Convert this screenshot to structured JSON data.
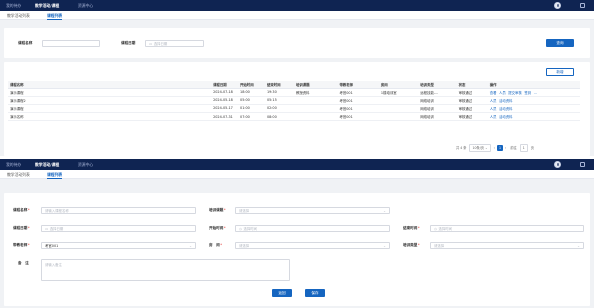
{
  "nav": {
    "items": [
      "我的待办",
      "教学活动/课程",
      "资源中心"
    ],
    "active_index": 1
  },
  "subtabs": {
    "items": [
      "教学活动列表",
      "课程列表"
    ],
    "active_index": 1
  },
  "list_view": {
    "search": {
      "course_name_label": "课程名称",
      "course_name_value": "",
      "course_date_label": "课程日期",
      "course_date_placeholder": "选择日期",
      "search_button": "查询"
    },
    "add_button": "新增",
    "table": {
      "columns": [
        "课程名称",
        "课程日期",
        "开始时间",
        "结束时间",
        "培训课题",
        "带教老师",
        "房间",
        "培训类型",
        "状态",
        "操作"
      ],
      "rows": [
        {
          "name": "演示课程",
          "date": "2024-07-18",
          "start": "18:00",
          "end": "19:30",
          "topic": "教授资料",
          "teacher": "考官001",
          "room": "1楼培训室",
          "type": "远程技能-...",
          "status": "审核通过",
          "actions": [
            "查看",
            "人员",
            "提交审核",
            "签到",
            "..."
          ]
        },
        {
          "name": "演示课程2",
          "date": "2024-05-18",
          "start": "05:00",
          "end": "05:15",
          "topic": "",
          "teacher": "考官001",
          "room": "",
          "type": "网络培训",
          "status": "审核通过",
          "actions": [
            "人员",
            "活动资料"
          ]
        },
        {
          "name": "演示课程",
          "date": "2024-05-17",
          "start": "01:00",
          "end": "02:00",
          "topic": "",
          "teacher": "考官001",
          "room": "",
          "type": "网络培训",
          "status": "审核通过",
          "actions": [
            "人员",
            "活动资料"
          ]
        },
        {
          "name": "演示名称",
          "date": "2024-07-31",
          "start": "07:00",
          "end": "08:00",
          "topic": "",
          "teacher": "考官001",
          "room": "",
          "type": "网络培训",
          "status": "审核通过",
          "actions": [
            "人员",
            "活动资料"
          ]
        }
      ]
    },
    "pagination": {
      "total": "共 4 条",
      "page_size": "10条/页",
      "prev": "‹",
      "current": "1",
      "next": "›",
      "goto_label": "前往",
      "goto_value": "1",
      "page_unit": "页"
    }
  },
  "form_view": {
    "name_label": "课程名称",
    "name_placeholder": "请输入课程名称",
    "topic_label": "培训课题",
    "topic_placeholder": "请选择",
    "date_label": "课程日期",
    "date_placeholder": "选择日期",
    "start_label": "开始时间",
    "start_placeholder": "选择时间",
    "end_label": "结束时间",
    "end_placeholder": "选择时间",
    "teacher_label": "带教老师",
    "teacher_value": "考官001",
    "room_label": "房　间",
    "room_placeholder": "请选择",
    "type_label": "培训类型",
    "type_placeholder": "请选择",
    "remark_label": "备　注",
    "remark_placeholder": "请输入备注",
    "back_button": "返回",
    "save_button": "保存"
  },
  "icons": {
    "calendar": "calendar-icon",
    "clock": "clock-icon",
    "chevron": "chevron-down-icon",
    "avatar": "user-avatar-icon",
    "apps": "apps-grid-icon"
  },
  "colors": {
    "nav_bg": "#0f2452",
    "primary": "#1565c0",
    "success": "#43a047",
    "required": "#e53935",
    "page_bg": "#f0f2f5"
  }
}
